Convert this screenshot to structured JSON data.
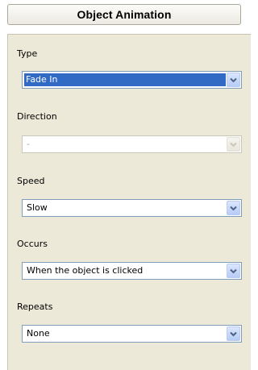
{
  "header": {
    "title": "Object Animation"
  },
  "fields": [
    {
      "label": "Type",
      "value": "Fade In",
      "selected": true,
      "disabled": false
    },
    {
      "label": "Direction",
      "value": "-",
      "selected": false,
      "disabled": true
    },
    {
      "label": "Speed",
      "value": "Slow",
      "selected": false,
      "disabled": false
    },
    {
      "label": "Occurs",
      "value": "When the object is clicked",
      "selected": false,
      "disabled": false
    },
    {
      "label": "Repeats",
      "value": "None",
      "selected": false,
      "disabled": false
    }
  ],
  "icons": {
    "dropdown": "chevron-down-icon"
  },
  "colors": {
    "panel_background": "#ece9d8",
    "selection_highlight": "#316ac5",
    "dropdown_arrow": "#4d6185",
    "dropdown_arrow_disabled": "#c9c7ba"
  }
}
